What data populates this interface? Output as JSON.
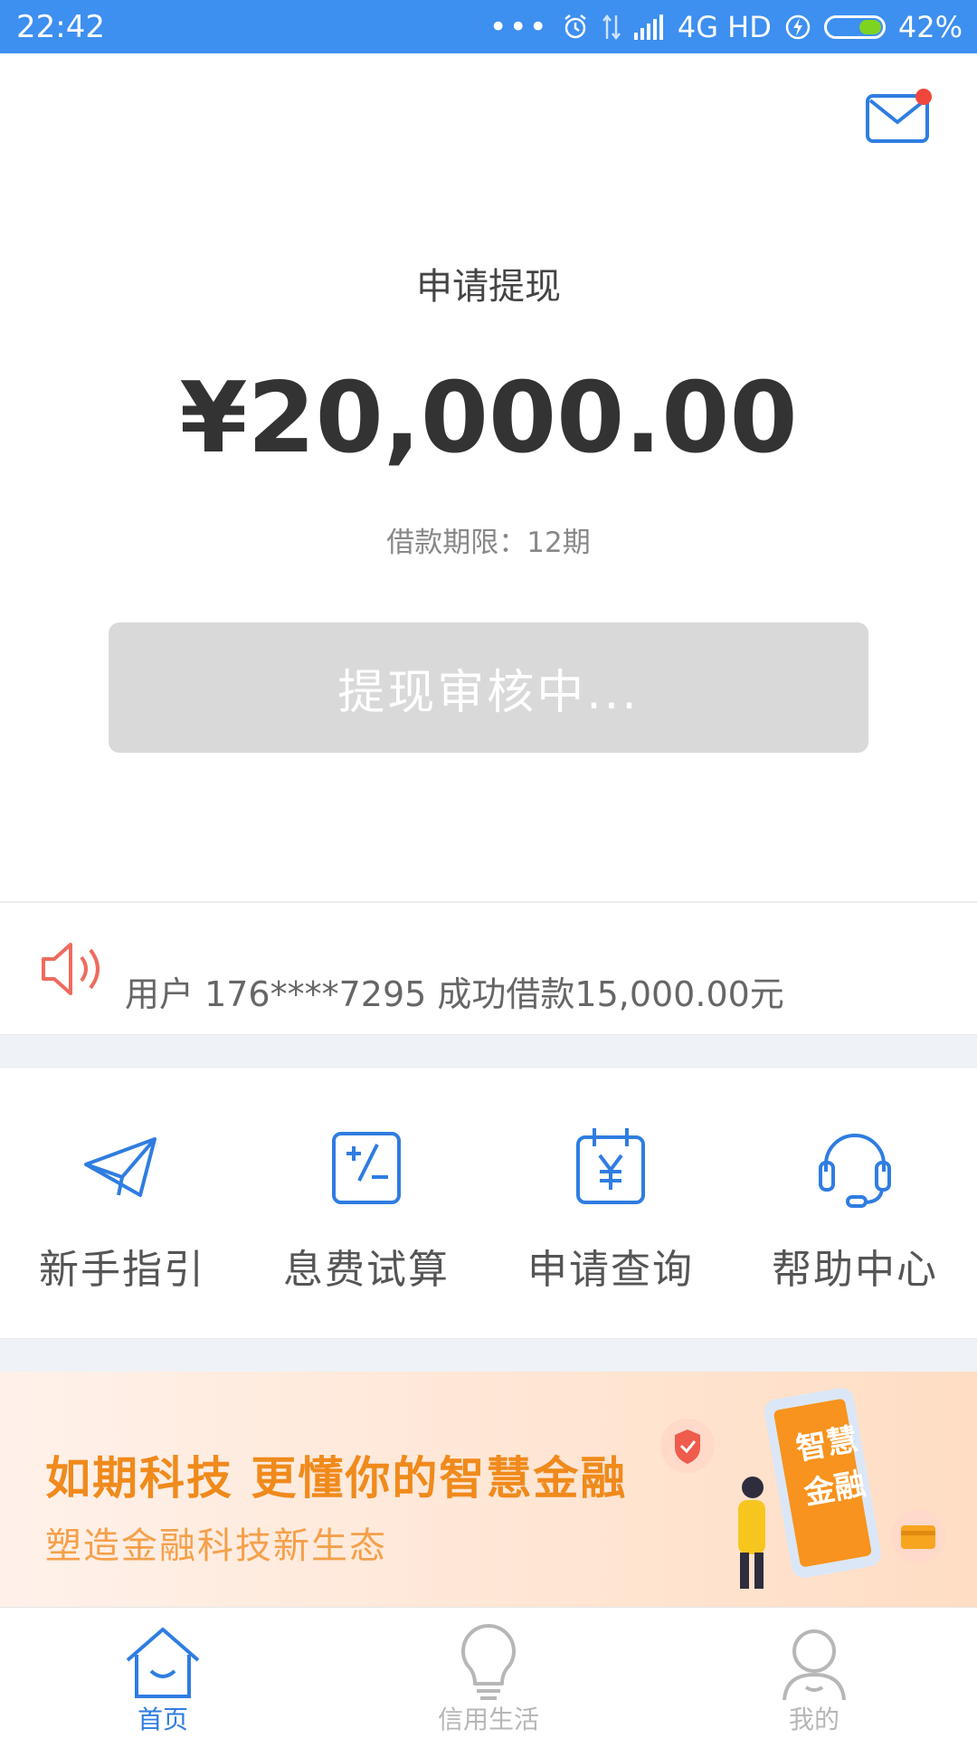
{
  "status_bar": {
    "time": "22:42",
    "network": "4G HD",
    "battery": "42%",
    "battery_level": 0.42
  },
  "main": {
    "title": "申请提现",
    "amount": "¥20,000.00",
    "term": "借款期限：12期",
    "button_label": "提现审核中..."
  },
  "notice": {
    "text": "用户 176****7295 成功借款15,000.00元",
    "icon": "speaker-icon"
  },
  "shortcuts": [
    {
      "label": "新手指引",
      "icon": "paper-plane-icon"
    },
    {
      "label": "息费试算",
      "icon": "calculator-icon"
    },
    {
      "label": "申请查询",
      "icon": "calendar-yen-icon"
    },
    {
      "label": "帮助中心",
      "icon": "headset-icon"
    }
  ],
  "banner": {
    "headline": "如期科技 更懂你的智慧金融",
    "subline": "塑造金融科技新生态",
    "phone_text": "智慧金融"
  },
  "tabs": [
    {
      "label": "首页",
      "icon": "home-icon",
      "active": true
    },
    {
      "label": "信用生活",
      "icon": "lightbulb-icon",
      "active": false
    },
    {
      "label": "我的",
      "icon": "user-icon",
      "active": false
    }
  ],
  "colors": {
    "status_bar": "#3d8ff0",
    "accent_blue": "#2f7de1",
    "banner_orange": "#f08a1c",
    "disabled_button": "#d9d9d9",
    "notification_dot": "#f0473c"
  }
}
